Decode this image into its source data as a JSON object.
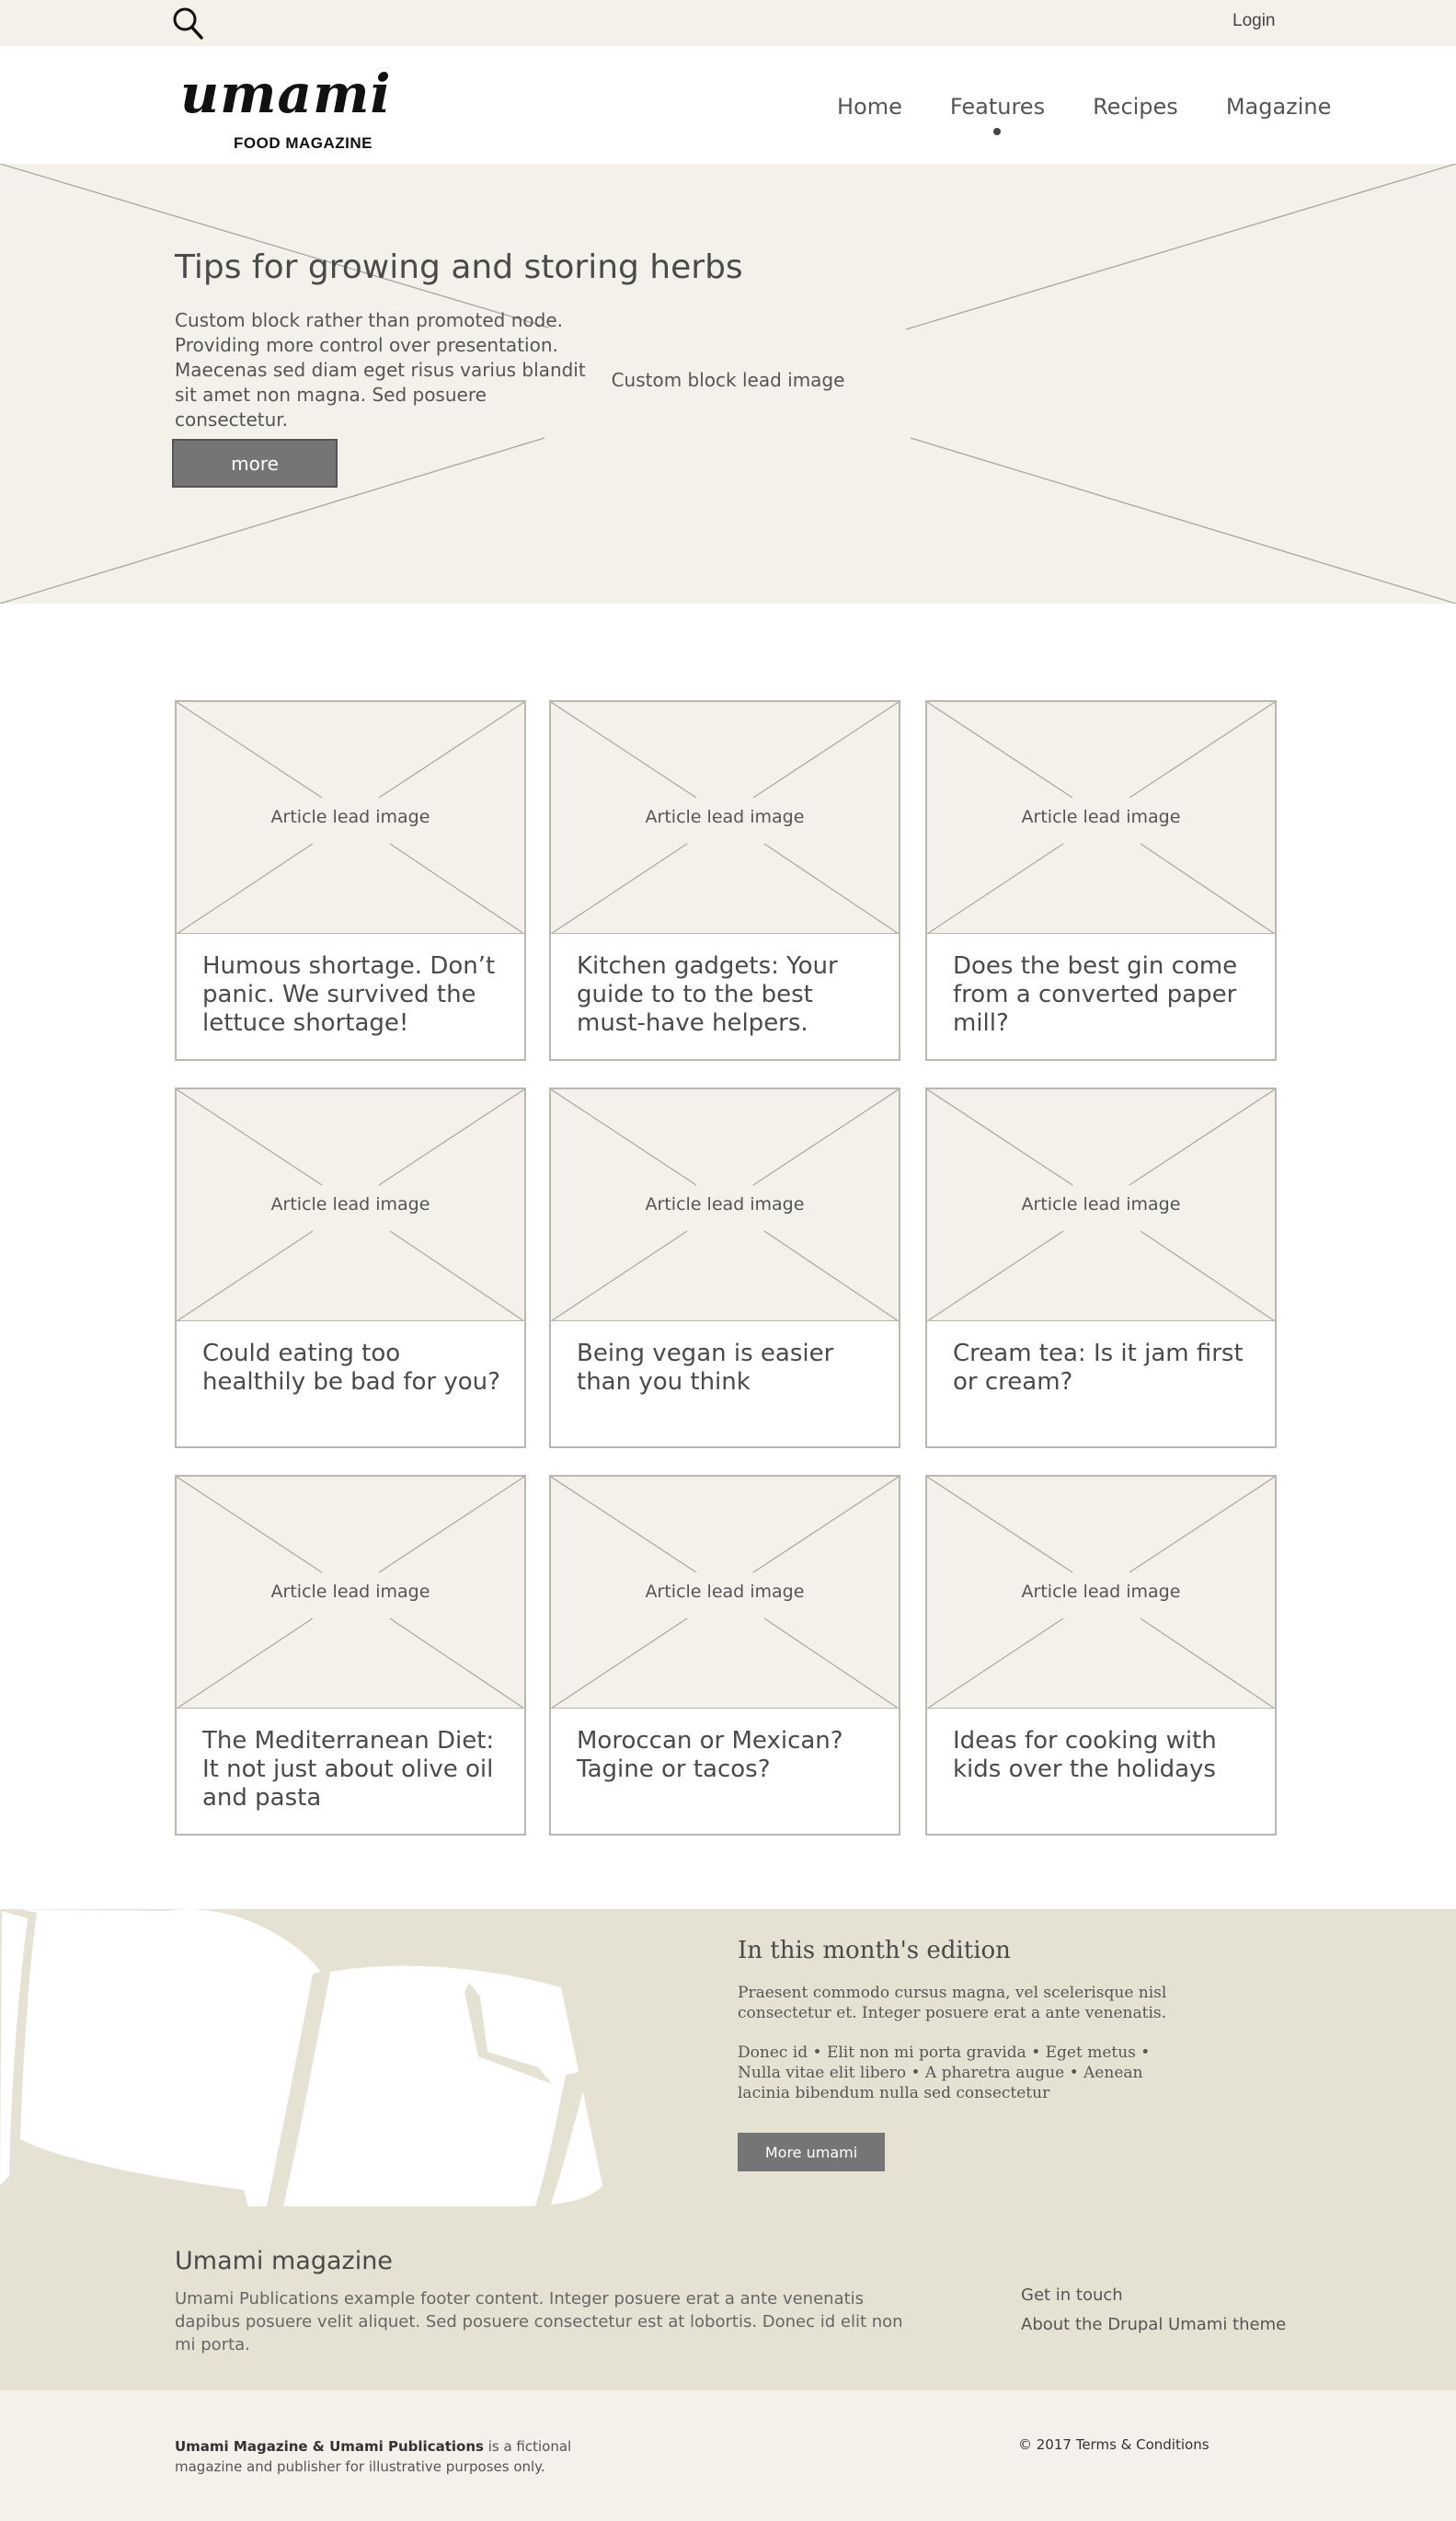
{
  "topbar": {
    "search_icon": "search-icon",
    "login_label": "Login"
  },
  "header": {
    "logo_word": "umami",
    "logo_sub": "FOOD MAGAZINE",
    "nav": [
      {
        "label": "Home",
        "active": false
      },
      {
        "label": "Features",
        "active": true
      },
      {
        "label": "Recipes",
        "active": false
      },
      {
        "label": "Magazine",
        "active": false
      }
    ]
  },
  "hero": {
    "title": "Tips for growing and storing herbs",
    "text": "Custom block rather than promoted node. Providing more control over presentation. Maecenas sed diam eget risus varius blandit sit amet non magna. Sed posuere consectetur.",
    "button_label": "more",
    "image_label": "Custom block lead image"
  },
  "articles": [
    {
      "image_label": "Article lead image",
      "title": "Humous shortage. Don’t panic. We survived the lettuce shortage!"
    },
    {
      "image_label": "Article lead image",
      "title": "Kitchen gadgets: Your guide to to the best must-have helpers."
    },
    {
      "image_label": "Article lead image",
      "title": "Does the best gin come from a converted paper mill?"
    },
    {
      "image_label": "Article lead image",
      "title": "Could eating too healthily be bad for you?"
    },
    {
      "image_label": "Article lead image",
      "title": "Being vegan is easier than you think"
    },
    {
      "image_label": "Article lead image",
      "title": "Cream tea: Is it jam first or cream?"
    },
    {
      "image_label": "Article lead image",
      "title": "The Mediterranean Diet: It not just about olive oil and pasta"
    },
    {
      "image_label": "Article lead image",
      "title": "Moroccan or Mexican? Tagine or tacos?"
    },
    {
      "image_label": "Article lead image",
      "title": "Ideas for cooking with kids over the holidays"
    }
  ],
  "edition": {
    "title": "In this month's edition",
    "p1": "Praesent commodo cursus magna, vel scelerisque nisl consectetur et. Integer posuere erat a ante venenatis.",
    "p2": "Donec id • Elit non mi porta gravida • Eget metus • Nulla vitae elit libero • A pharetra augue • Aenean lacinia bibendum nulla sed consectetur",
    "button_label": "More umami"
  },
  "footer": {
    "title": "Umami magazine",
    "text": "Umami Publications example footer content. Integer posuere erat a ante venenatis dapibus posuere velit aliquet. Sed posuere consectetur est at lobortis. Donec id elit non mi porta.",
    "links": [
      "Get in touch",
      "About the Drupal Umami theme"
    ]
  },
  "bottom": {
    "bold": "Umami Magazine & Umami Publications",
    "rest": " is a fictional magazine and publisher for illustrative purposes only.",
    "copyright": "© 2017 Terms & Conditions"
  },
  "colors": {
    "cream": "#f3f1ea",
    "beige": "#e5e2d4",
    "button": "#757575",
    "text": "#464646"
  }
}
